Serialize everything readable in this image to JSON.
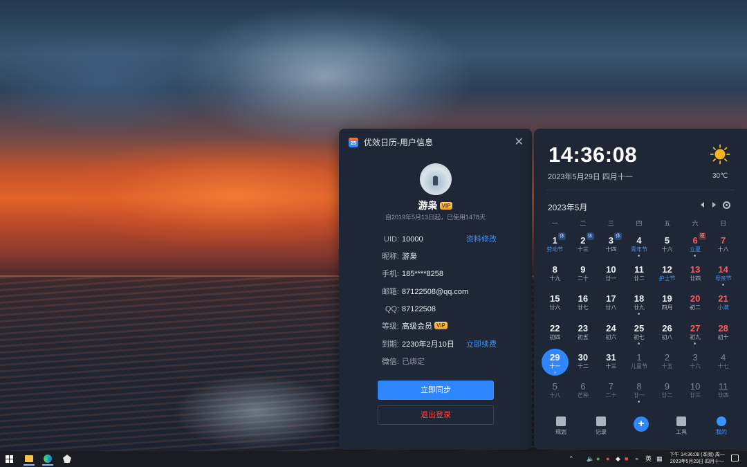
{
  "user_panel": {
    "title": "优效日历-用户信息",
    "app_icon_text": "25",
    "close": "✕",
    "nickname": "游枭",
    "vip": "VIP",
    "since": "自2019年5月13日起，已使用1478天",
    "rows": [
      {
        "label": "UID:",
        "value": "10000",
        "link": "资料修改"
      },
      {
        "label": "昵称:",
        "value": "游枭"
      },
      {
        "label": "手机:",
        "value": "185****8258"
      },
      {
        "label": "邮箱:",
        "value": "87122508@qq.com"
      },
      {
        "label": "QQ:",
        "value": "87122508"
      },
      {
        "label": "等级:",
        "value": "高级会员"
      },
      {
        "label": "到期:",
        "value": "2230年2月10日",
        "link": "立即续费"
      },
      {
        "label": "微信:",
        "value": "已绑定"
      }
    ],
    "sync_button": "立即同步",
    "logout_button": "退出登录"
  },
  "calendar": {
    "time": "14:36:08",
    "date": "2023年5月29日 四月十一",
    "temperature": "30℃",
    "weather_icon": "sun-icon",
    "month": "2023年5月",
    "weekdays": [
      "一",
      "二",
      "三",
      "四",
      "五",
      "六",
      "日"
    ],
    "cells": [
      {
        "d": "1",
        "l": "劳动节",
        "blue": true,
        "tag": "休"
      },
      {
        "d": "2",
        "l": "十三",
        "tag": "休"
      },
      {
        "d": "3",
        "l": "十四",
        "tag": "休"
      },
      {
        "d": "4",
        "l": "青年节",
        "blue": true,
        "dot": true
      },
      {
        "d": "5",
        "l": "十六"
      },
      {
        "d": "6",
        "l": "立夏",
        "blue": true,
        "weekend": true,
        "dot": true,
        "tag": "班",
        "tagType": "work"
      },
      {
        "d": "7",
        "l": "十八",
        "weekend": true
      },
      {
        "d": "8",
        "l": "十九"
      },
      {
        "d": "9",
        "l": "二十"
      },
      {
        "d": "10",
        "l": "廿一"
      },
      {
        "d": "11",
        "l": "廿二"
      },
      {
        "d": "12",
        "l": "护士节",
        "blue": true
      },
      {
        "d": "13",
        "l": "廿四",
        "weekend": true
      },
      {
        "d": "14",
        "l": "母亲节",
        "blue": true,
        "weekend": true,
        "dot": true
      },
      {
        "d": "15",
        "l": "廿六"
      },
      {
        "d": "16",
        "l": "廿七"
      },
      {
        "d": "17",
        "l": "廿八"
      },
      {
        "d": "18",
        "l": "廿九",
        "dot": true
      },
      {
        "d": "19",
        "l": "四月"
      },
      {
        "d": "20",
        "l": "初二",
        "weekend": true
      },
      {
        "d": "21",
        "l": "小满",
        "blue": true,
        "weekend": true
      },
      {
        "d": "22",
        "l": "初四"
      },
      {
        "d": "23",
        "l": "初五"
      },
      {
        "d": "24",
        "l": "初六"
      },
      {
        "d": "25",
        "l": "初七",
        "dot": true
      },
      {
        "d": "26",
        "l": "初八"
      },
      {
        "d": "27",
        "l": "初九",
        "weekend": true,
        "dot": true
      },
      {
        "d": "28",
        "l": "初十",
        "weekend": true
      },
      {
        "d": "29",
        "l": "十一",
        "today": true,
        "dot": true
      },
      {
        "d": "30",
        "l": "十二"
      },
      {
        "d": "31",
        "l": "十三"
      },
      {
        "d": "1",
        "l": "儿童节",
        "other": true
      },
      {
        "d": "2",
        "l": "十五",
        "other": true
      },
      {
        "d": "3",
        "l": "十六",
        "other": true
      },
      {
        "d": "4",
        "l": "十七",
        "other": true
      },
      {
        "d": "5",
        "l": "十八",
        "other": true
      },
      {
        "d": "6",
        "l": "芒种",
        "other": true
      },
      {
        "d": "7",
        "l": "二十",
        "other": true
      },
      {
        "d": "8",
        "l": "廿一",
        "other": true,
        "dot": true
      },
      {
        "d": "9",
        "l": "廿二",
        "other": true
      },
      {
        "d": "10",
        "l": "廿三",
        "other": true
      },
      {
        "d": "11",
        "l": "廿四",
        "other": true
      }
    ],
    "nav": [
      {
        "label": "规划",
        "icon": "clipboard-icon"
      },
      {
        "label": "记录",
        "icon": "record-icon"
      },
      {
        "label": "+",
        "icon": "plus-icon"
      },
      {
        "label": "工具",
        "icon": "cube-icon"
      },
      {
        "label": "我的",
        "icon": "user-icon"
      }
    ]
  },
  "taskbar": {
    "ime": "英",
    "clock_line1": "下午 14:36:08 (本阅) 周一",
    "clock_line2": "2023年5月29日 四月十一"
  }
}
